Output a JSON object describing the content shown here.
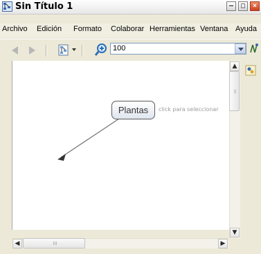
{
  "window": {
    "title": "Sin Título 1",
    "controls": [
      "minimize",
      "maximize",
      "close"
    ]
  },
  "menu": {
    "items": [
      "Archivo",
      "Edición",
      "Formato",
      "Colaborar",
      "Herramientas",
      "Ventana",
      "Ayuda"
    ]
  },
  "toolbar": {
    "zoom_value": "100",
    "icons": [
      "back-arrow-icon",
      "forward-arrow-icon",
      "view-options-icon",
      "zoom-icon",
      "map-icon"
    ]
  },
  "canvas": {
    "concept_label": "Plantas",
    "hint_text": "click para seleccionar"
  },
  "colors": {
    "arrow": "#777777",
    "node_border": "#5a5a5a",
    "background": "#ece9d8"
  }
}
